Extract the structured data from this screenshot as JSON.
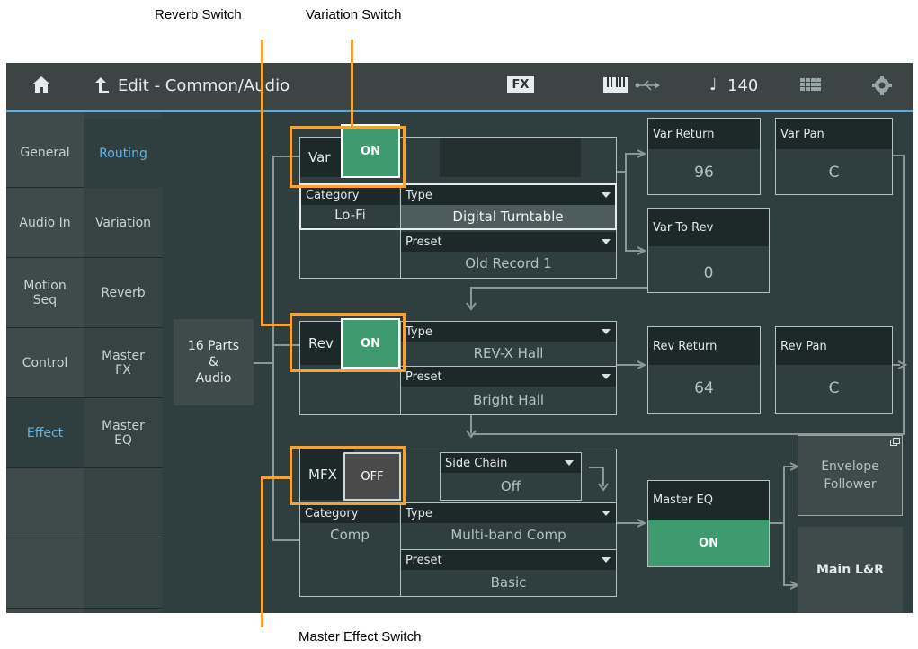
{
  "callouts": {
    "reverb_switch": "Reverb Switch",
    "variation_switch": "Variation Switch",
    "master_effect_switch": "Master Effect Switch"
  },
  "topbar": {
    "title": "Edit - Common/Audio",
    "fx_label": "FX",
    "tempo_symbol": "♩",
    "tempo_value": "140",
    "icons": [
      "home-icon",
      "back-icon",
      "fx-icon",
      "keyboard-icon",
      "usb-icon",
      "note-icon",
      "grid-icon",
      "gear-icon"
    ]
  },
  "tabs_left": [
    "General",
    "Audio In",
    "Motion Seq",
    "Control",
    "Effect"
  ],
  "tabs_left_motion": [
    "Motion",
    "Seq"
  ],
  "tabs_sub": [
    "Routing",
    "Variation",
    "Reverb",
    "Master FX",
    "Master EQ"
  ],
  "tabs_sub_masterfx": [
    "Master",
    "FX"
  ],
  "tabs_sub_mastereq": [
    "Master",
    "EQ"
  ],
  "selected_tab": "Effect",
  "selected_sub": "Routing",
  "source": [
    "16 Parts",
    "&",
    "Audio"
  ],
  "var_block": {
    "label": "Var",
    "switch": "ON",
    "category_label": "Category",
    "category_value": "Lo-Fi",
    "type_label": "Type",
    "type_value": "Digital Turntable",
    "preset_label": "Preset",
    "preset_value": "Old Record 1"
  },
  "var_return": {
    "label": "Var Return",
    "value": "96"
  },
  "var_pan": {
    "label": "Var Pan",
    "value": "C"
  },
  "var_to_rev": {
    "label": "Var To Rev",
    "value": "0"
  },
  "rev_block": {
    "label": "Rev",
    "switch": "ON",
    "type_label": "Type",
    "type_value": "REV-X Hall",
    "preset_label": "Preset",
    "preset_value": "Bright Hall"
  },
  "rev_return": {
    "label": "Rev Return",
    "value": "64"
  },
  "rev_pan": {
    "label": "Rev Pan",
    "value": "C"
  },
  "mfx_block": {
    "label": "MFX",
    "switch": "OFF",
    "side_chain_label": "Side Chain",
    "side_chain_value": "Off",
    "category_label": "Category",
    "category_value": "Comp",
    "type_label": "Type",
    "type_value": "Multi-band Comp",
    "preset_label": "Preset",
    "preset_value": "Basic"
  },
  "master_eq": {
    "label": "Master EQ",
    "switch": "ON"
  },
  "envelope_follower": [
    "Envelope",
    "Follower"
  ],
  "main_out": "Main L&R",
  "colors": {
    "on": "#3f9a70",
    "off": "#4a4a4a",
    "accent": "#f3a33a",
    "tab_active": "#5fb6e6"
  }
}
